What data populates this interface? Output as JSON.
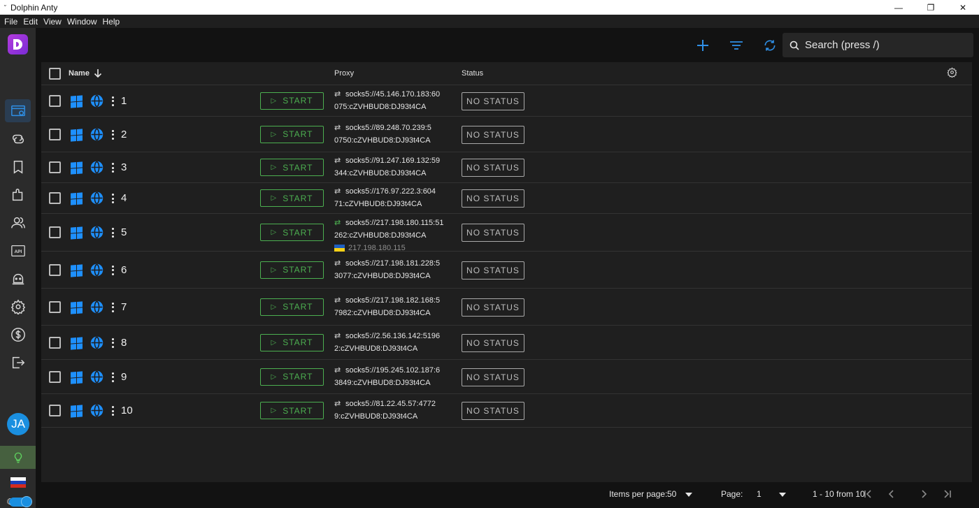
{
  "window": {
    "title": "Dolphin Anty",
    "minimize": "—",
    "maximize": "❐",
    "close": "✕"
  },
  "menu": [
    "File",
    "Edit",
    "View",
    "Window",
    "Help"
  ],
  "sidebar": {
    "items": [
      {
        "icon": "browser-profiles-icon",
        "active": true
      },
      {
        "icon": "link-icon"
      },
      {
        "icon": "bookmark-icon"
      },
      {
        "icon": "extensions-icon"
      },
      {
        "icon": "users-icon"
      },
      {
        "icon": "api-icon"
      },
      {
        "icon": "robot-icon"
      },
      {
        "icon": "settings-icon"
      },
      {
        "icon": "dollar-icon"
      },
      {
        "icon": "logout-icon"
      }
    ],
    "avatar": "JA",
    "api_label": "API"
  },
  "search": {
    "placeholder": "Search (press /)"
  },
  "table": {
    "columns": {
      "name": "Name",
      "proxy": "Proxy",
      "status": "Status"
    },
    "start_label": "START",
    "rows": [
      {
        "name": "1",
        "proxy_line1": "socks5://45.146.170.183:60",
        "proxy_line2": "075:cZVHBUD8:DJ93t4CA",
        "status": "NO STATUS"
      },
      {
        "name": "2",
        "proxy_line1": "socks5://89.248.70.239:5",
        "proxy_line2": "0750:cZVHBUD8:DJ93t4CA",
        "status": "NO STATUS"
      },
      {
        "name": "3",
        "proxy_line1": "socks5://91.247.169.132:59",
        "proxy_line2": "344:cZVHBUD8:DJ93t4CA",
        "status": "NO STATUS"
      },
      {
        "name": "4",
        "proxy_line1": "socks5://176.97.222.3:604",
        "proxy_line2": "71:cZVHBUD8:DJ93t4CA",
        "status": "NO STATUS"
      },
      {
        "name": "5",
        "proxy_line1": "socks5://217.198.180.115:51",
        "proxy_line2": "262:cZVHBUD8:DJ93t4CA",
        "proxy_ip": "217.198.180.115",
        "status": "NO STATUS"
      },
      {
        "name": "6",
        "proxy_line1": "socks5://217.198.181.228:5",
        "proxy_line2": "3077:cZVHBUD8:DJ93t4CA",
        "status": "NO STATUS"
      },
      {
        "name": "7",
        "proxy_line1": "socks5://217.198.182.168:5",
        "proxy_line2": "7982:cZVHBUD8:DJ93t4CA",
        "status": "NO STATUS"
      },
      {
        "name": "8",
        "proxy_line1": "socks5://2.56.136.142:5196",
        "proxy_line2": "2:cZVHBUD8:DJ93t4CA",
        "status": "NO STATUS"
      },
      {
        "name": "9",
        "proxy_line1": "socks5://195.245.102.187:6",
        "proxy_line2": "3849:cZVHBUD8:DJ93t4CA",
        "status": "NO STATUS"
      },
      {
        "name": "10",
        "proxy_line1": "socks5://81.22.45.57:4772",
        "proxy_line2": "9:cZVHBUD8:DJ93t4CA",
        "status": "NO STATUS"
      }
    ]
  },
  "pagination": {
    "items_per_page_label": "Items per page:",
    "items_per_page": "50",
    "page_label": "Page:",
    "page": "1",
    "range": "1 - 10 from 10"
  },
  "colors": {
    "accent": "#1e90ff",
    "start_green": "#4caf50",
    "logo_purple": "#9b34d8"
  }
}
